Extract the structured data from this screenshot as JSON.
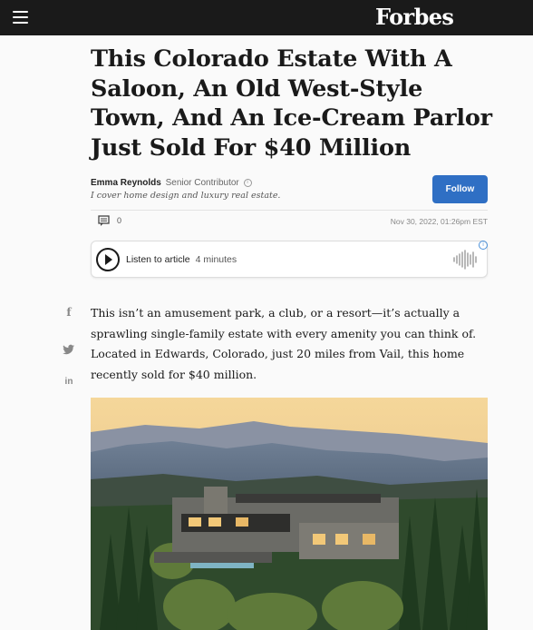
{
  "header": {
    "logo": "Forbes",
    "menu_icon": "hamburger-menu-icon"
  },
  "article": {
    "headline": "This Colorado Estate With A Saloon, An Old West-Style Town, And An Ice-Cream Parlor Just Sold For $40 Million",
    "author": {
      "name": "Emma Reynolds",
      "role": "Senior Contributor",
      "bio": "I cover home design and luxury real estate.",
      "follow_label": "Follow"
    },
    "comment_count": "0",
    "date": "Nov 30, 2022, 01:26pm EST",
    "audio": {
      "label": "Listen to article",
      "duration": "4 minutes"
    },
    "body": "This isn’t an amusement park, a club, or a resort—it’s actually a sprawling single-family estate with every amenity you can think of. Located in Edwards, Colorado, just 20 miles from Vail, this home recently sold for $40 million."
  },
  "social": {
    "facebook": "f",
    "linkedin": "in"
  },
  "colors": {
    "topbar": "#1a1a1a",
    "follow_button": "#2f6fc4"
  }
}
